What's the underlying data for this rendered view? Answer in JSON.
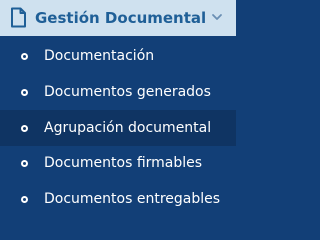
{
  "header": {
    "icon": "document-icon",
    "title": "Gestión Documental",
    "chevron": "chevron-down-icon"
  },
  "items": [
    {
      "label": "Documentación",
      "icon": "bullet-icon",
      "selected": false
    },
    {
      "label": "Documentos generados",
      "icon": "bullet-icon",
      "selected": false
    },
    {
      "label": "Agrupación documental",
      "icon": "bullet-icon",
      "selected": true
    },
    {
      "label": "Documentos firmables",
      "icon": "bullet-icon",
      "selected": false
    },
    {
      "label": "Documentos entregables",
      "icon": "bullet-icon",
      "selected": false
    }
  ],
  "colors": {
    "panel_bg": "#123f77",
    "header_bg": "#cfe1ef",
    "header_text": "#1f5f97",
    "selected_bg": "#0f3463",
    "item_text": "#ffffff"
  }
}
